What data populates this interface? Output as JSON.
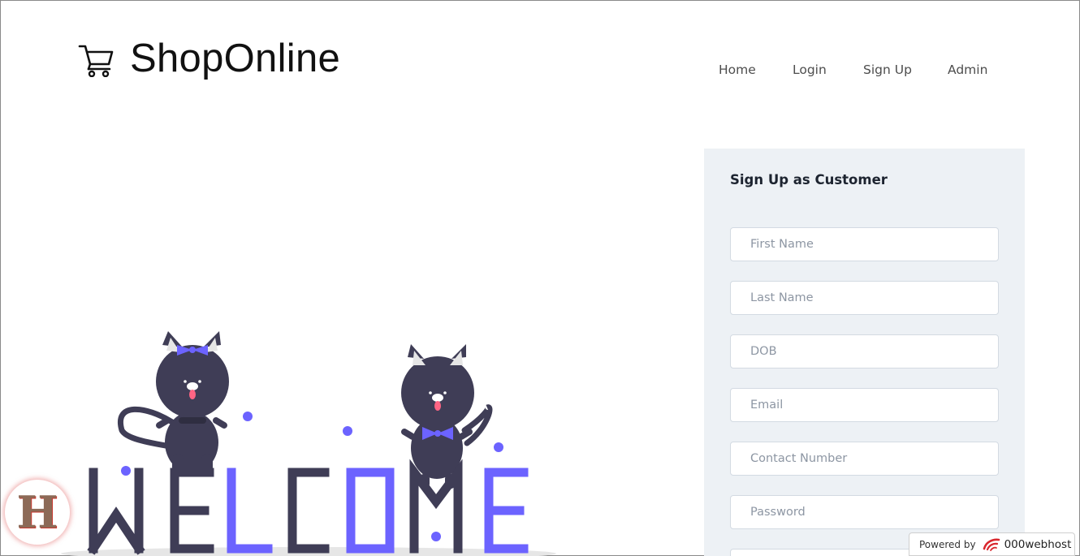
{
  "brand": {
    "name": "ShopOnline",
    "icon": "shopping-cart-icon"
  },
  "nav": {
    "items": [
      {
        "label": "Home"
      },
      {
        "label": "Login"
      },
      {
        "label": "Sign Up"
      },
      {
        "label": "Admin"
      }
    ]
  },
  "hero": {
    "illustration": "welcome-cats-illustration",
    "word": "WELCOME"
  },
  "form": {
    "title": "Sign Up as Customer",
    "fields": [
      {
        "placeholder": "First Name"
      },
      {
        "placeholder": "Last Name"
      },
      {
        "placeholder": "DOB"
      },
      {
        "placeholder": "Email"
      },
      {
        "placeholder": "Contact Number"
      },
      {
        "placeholder": "Password"
      },
      {
        "placeholder": ""
      }
    ]
  },
  "badge": {
    "letter": "H"
  },
  "footer": {
    "powered_label": "Powered by",
    "powered_brand": "000webhost",
    "icon": "webhost-logo-icon"
  },
  "colors": {
    "accent": "#6c63ff",
    "dark": "#3f3d56",
    "panel": "#edf1f5"
  }
}
